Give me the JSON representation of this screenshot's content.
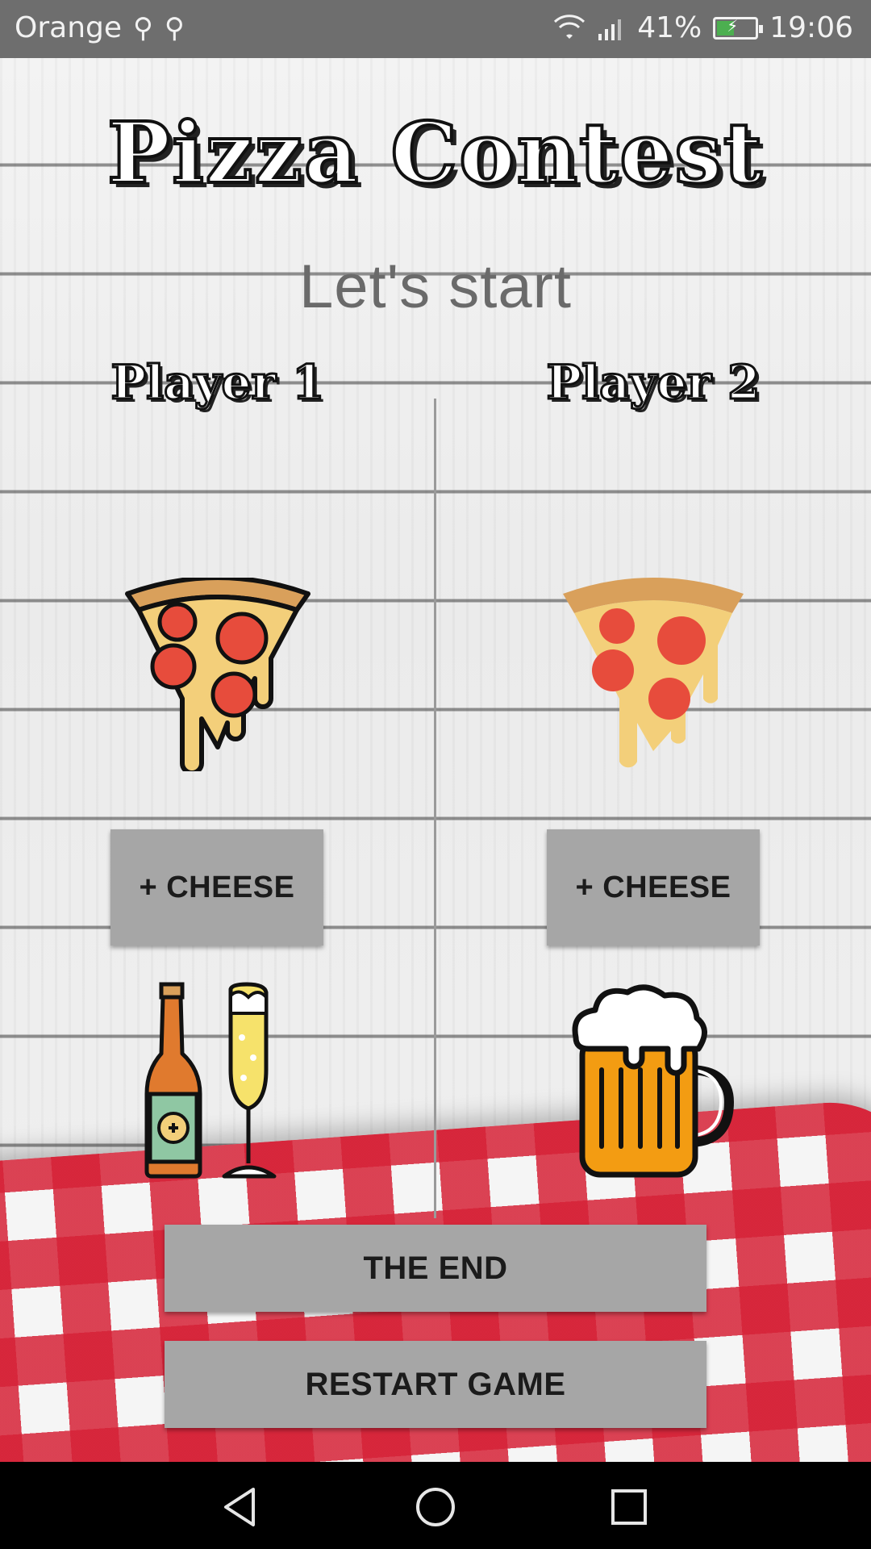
{
  "status_bar": {
    "carrier": "Orange",
    "usb_icons": [
      "usb-icon",
      "usb-icon"
    ],
    "battery_percent": "41%",
    "time": "19:06",
    "battery_level": 0.41,
    "colors": {
      "bar": "#6e6e6e",
      "battery_fill": "#4caf50"
    }
  },
  "app": {
    "title": "Pizza Contest",
    "subtitle": "Let's start"
  },
  "players": [
    {
      "label": "Player 1",
      "cheese_button": "+ CHEESE",
      "pizza_icon": "pizza-slice-outlined-icon",
      "drink_icon": "beer-bottle-and-champagne-glass-icon"
    },
    {
      "label": "Player 2",
      "cheese_button": "+ CHEESE",
      "pizza_icon": "pizza-slice-flat-icon",
      "drink_icon": "beer-mug-icon"
    }
  ],
  "actions": {
    "end_label": "THE END",
    "restart_label": "RESTART GAME"
  },
  "nav_bar": {
    "icons": [
      "back-icon",
      "home-icon",
      "recent-apps-icon"
    ]
  },
  "colors": {
    "button": "#a6a6a6",
    "button_text": "#1b1b1b",
    "subtitle": "#6a6a6a",
    "pepperoni": "#e74c3c",
    "cheese": "#f3cf7a",
    "crust": "#d9a05b",
    "tablecloth_red": "#d62237"
  }
}
